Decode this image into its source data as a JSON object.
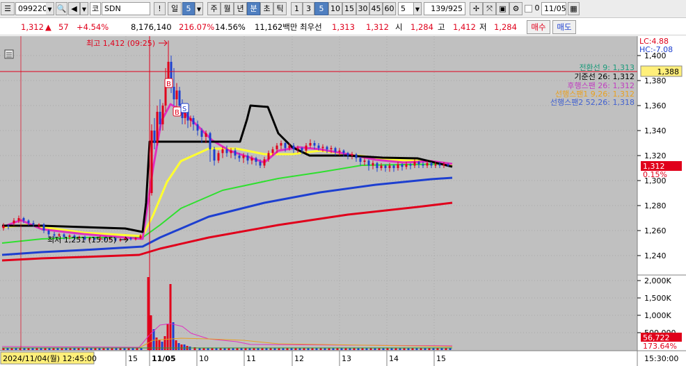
{
  "toolbar": {
    "code": "099220",
    "market_prefix": "코",
    "name": "SDN",
    "excl": "!",
    "period_minute": "일",
    "interval_value": "5",
    "tabs": [
      "주",
      "월",
      "년",
      "분",
      "초",
      "틱"
    ],
    "selected_tab": "분",
    "intervals": [
      "1",
      "3",
      "5",
      "10",
      "15",
      "30",
      "45",
      "60"
    ],
    "selected_interval": "5",
    "custom_interval": "5",
    "count": "139/925",
    "zero_label": "0",
    "date": "11/05"
  },
  "quote": {
    "price": "1,312",
    "change": "57",
    "change_pct": "+4.54%",
    "volume": "8,176,140",
    "volume_ratio": "216.07%",
    "turnover": "14.56%",
    "amount": "11,162백만",
    "best_ask_label": "최우선",
    "best_ask": "1,313",
    "best_bid": "1,312",
    "open_label": "시",
    "open": "1,284",
    "high_label": "고",
    "high": "1,412",
    "low_label": "저",
    "low": "1,284",
    "buy_label": "매수",
    "sell_label": "매도"
  },
  "chart": {
    "high_annotation": "최고 1,412 (09:25)",
    "low_annotation": "최저 1,251 (15:05)",
    "lc": "LC:4.88",
    "hc": "HC:-7.08",
    "crosshair_price": "1,388",
    "current_price": "1,312",
    "current_pct": "0.15%",
    "legend": [
      {
        "text": "전환선 9: 1,313",
        "color": "#1a9a7a"
      },
      {
        "text": "기준선 26: 1,312",
        "color": "#000000"
      },
      {
        "text": "후행스팬 26: 1,312",
        "color": "#c03cc0"
      },
      {
        "text": "선행스팬1 9,26: 1,312",
        "color": "#e8a020"
      },
      {
        "text": "선행스팬2 52,26: 1,318",
        "color": "#4060d0"
      }
    ],
    "price_ticks": [
      "1,400",
      "1,380",
      "1,360",
      "1,340",
      "1,320",
      "1,300",
      "1,280",
      "1,260",
      "1,240"
    ],
    "volume_ticks": [
      "2,000K",
      "1,500K",
      "1,000K",
      "500,000"
    ],
    "volume_current": "56,722",
    "volume_pct": "173.64%",
    "time_start": "2024/11/04(월) 12:45:00",
    "time_labels": [
      "15",
      "11/05",
      "10",
      "11",
      "12",
      "13",
      "14",
      "15"
    ],
    "time_end": "15:30:00",
    "colors": {
      "bg": "#c0c0c0",
      "up": "#e0001b",
      "down": "#1d3fd0"
    }
  }
}
